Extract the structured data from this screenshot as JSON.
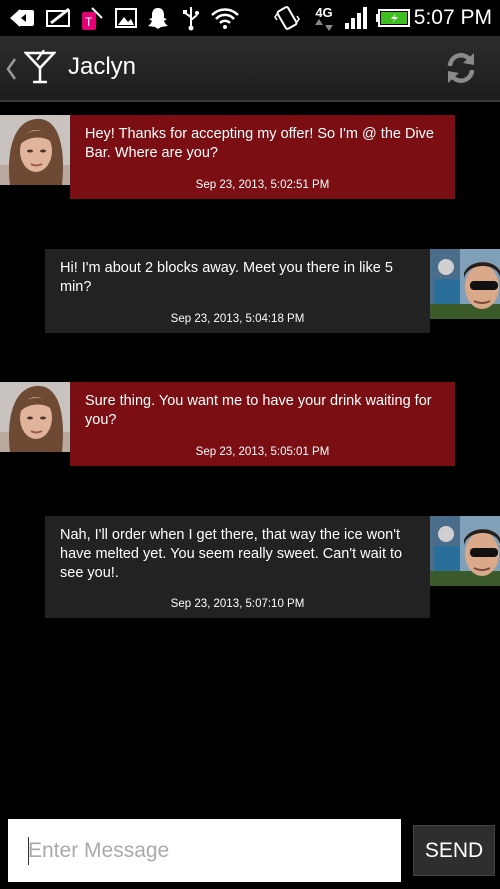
{
  "status_bar": {
    "time": "5:07 PM",
    "network": "4G",
    "carrier_badge": "T",
    "icons": [
      "back-arrow-icon",
      "mail-icon",
      "tmobile-icon",
      "image-icon",
      "snapchat-icon",
      "usb-icon",
      "wifi-icon",
      "vibrate-icon",
      "network-4g-icon",
      "signal-icon",
      "battery-icon"
    ]
  },
  "header": {
    "title": "Jaclyn",
    "icons": [
      "back-chevron-icon",
      "cocktail-icon",
      "refresh-icon"
    ]
  },
  "messages": [
    {
      "direction": "incoming",
      "text": "Hey!  Thanks for accepting my offer!  So I'm @ the Dive Bar. Where are you?",
      "timestamp": "Sep 23, 2013, 5:02:51 PM"
    },
    {
      "direction": "outgoing",
      "text": "Hi! I'm about 2 blocks away. Meet you there in like 5 min?",
      "timestamp": "Sep 23, 2013, 5:04:18 PM"
    },
    {
      "direction": "incoming",
      "text": "Sure thing. You want me to have your drink waiting for you?",
      "timestamp": "Sep 23, 2013, 5:05:01 PM"
    },
    {
      "direction": "outgoing",
      "text": "Nah, I'll order when I get there, that way the ice won't have melted yet. You seem really sweet. Can't wait to see you!.",
      "timestamp": "Sep 23, 2013, 5:07:10 PM"
    }
  ],
  "composer": {
    "placeholder": "Enter Message",
    "value": "",
    "send_label": "SEND"
  },
  "colors": {
    "incoming_bubble": "#7a0e12",
    "outgoing_bubble": "#222222",
    "background": "#000000",
    "battery_green": "#3fbf1f"
  }
}
